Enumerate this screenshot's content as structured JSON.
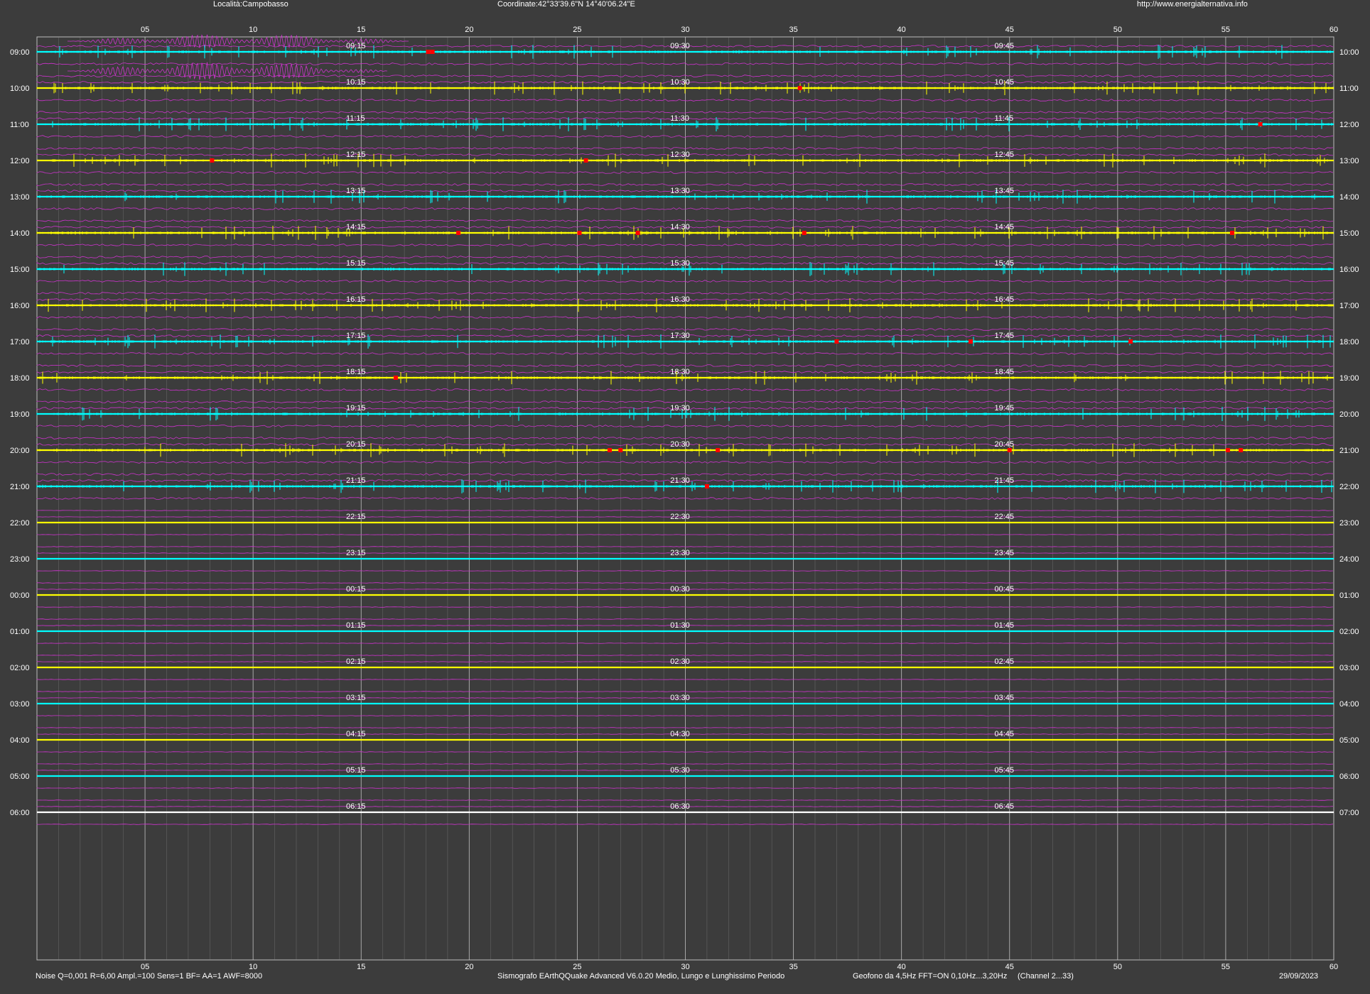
{
  "header": {
    "location": "Località:Campobasso",
    "coordinates": "Coordinate:42°33'39.6\"N  14°40'06.24\"E",
    "url": "http://www.energialternativa.info"
  },
  "footer": {
    "noise": "Noise Q=0,001 R=6,00 Ampl.=100 Sens=1 BF= AA=1 AWF=8000",
    "software": "Sismografo  EArthQQuake Advanced V6.0.20  Medio, Lungo e Lunghissimo Periodo",
    "geofono": "Geofono da 4,5Hz FFT=ON 0,10Hz...3,20Hz",
    "channel": "(Channel 2...33)",
    "date": "29/09/2023"
  },
  "minute_ticks": [
    "05",
    "10",
    "15",
    "20",
    "25",
    "30",
    "35",
    "40",
    "45",
    "50",
    "55",
    "60"
  ],
  "rows": [
    {
      "left": "09:00",
      "right": "10:00",
      "q15": "09:15",
      "q30": "09:30",
      "q45": "09:45",
      "color": "#00ffff",
      "activity": 1,
      "events": [
        18.1,
        18.3
      ]
    },
    {
      "left": "10:00",
      "right": "11:00",
      "q15": "10:15",
      "q30": "10:30",
      "q45": "10:45",
      "color": "#ffff00",
      "activity": 1,
      "events": [
        35.3
      ]
    },
    {
      "left": "11:00",
      "right": "12:00",
      "q15": "11:15",
      "q30": "11:30",
      "q45": "11:45",
      "color": "#00ffff",
      "activity": 1,
      "events": [
        56.6
      ]
    },
    {
      "left": "12:00",
      "right": "13:00",
      "q15": "12:15",
      "q30": "12:30",
      "q45": "12:45",
      "color": "#ffff00",
      "activity": 1,
      "events": [
        8.1,
        25.4
      ]
    },
    {
      "left": "13:00",
      "right": "14:00",
      "q15": "13:15",
      "q30": "13:30",
      "q45": "13:45",
      "color": "#00ffff",
      "activity": 1,
      "events": []
    },
    {
      "left": "14:00",
      "right": "15:00",
      "q15": "14:15",
      "q30": "14:30",
      "q45": "14:45",
      "color": "#ffff00",
      "activity": 1,
      "events": [
        19.5,
        25.1,
        27.8,
        35.5,
        55.3
      ]
    },
    {
      "left": "15:00",
      "right": "16:00",
      "q15": "15:15",
      "q30": "15:30",
      "q45": "15:45",
      "color": "#00ffff",
      "activity": 1,
      "events": []
    },
    {
      "left": "16:00",
      "right": "17:00",
      "q15": "16:15",
      "q30": "16:30",
      "q45": "16:45",
      "color": "#ffff00",
      "activity": 1,
      "events": []
    },
    {
      "left": "17:00",
      "right": "18:00",
      "q15": "17:15",
      "q30": "17:30",
      "q45": "17:45",
      "color": "#00ffff",
      "activity": 1,
      "events": [
        37.0,
        43.2,
        50.6
      ]
    },
    {
      "left": "18:00",
      "right": "19:00",
      "q15": "18:15",
      "q30": "18:30",
      "q45": "18:45",
      "color": "#ffff00",
      "activity": 1,
      "events": [
        16.6
      ]
    },
    {
      "left": "19:00",
      "right": "20:00",
      "q15": "19:15",
      "q30": "19:30",
      "q45": "19:45",
      "color": "#00ffff",
      "activity": 1,
      "events": []
    },
    {
      "left": "20:00",
      "right": "21:00",
      "q15": "20:15",
      "q30": "20:30",
      "q45": "20:45",
      "color": "#ffff00",
      "activity": 1,
      "events": [
        26.5,
        27.0,
        31.5,
        45.0,
        55.1,
        55.7
      ]
    },
    {
      "left": "21:00",
      "right": "22:00",
      "q15": "21:15",
      "q30": "21:30",
      "q45": "21:45",
      "color": "#00ffff",
      "activity": 1,
      "events": [
        31.0
      ]
    },
    {
      "left": "22:00",
      "right": "23:00",
      "q15": "22:15",
      "q30": "22:30",
      "q45": "22:45",
      "color": "#ffff00",
      "activity": 0,
      "events": []
    },
    {
      "left": "23:00",
      "right": "24:00",
      "q15": "23:15",
      "q30": "23:30",
      "q45": "23:45",
      "color": "#00ffff",
      "activity": 0,
      "events": []
    },
    {
      "left": "00:00",
      "right": "01:00",
      "q15": "00:15",
      "q30": "00:30",
      "q45": "00:45",
      "color": "#ffff00",
      "activity": 0,
      "events": []
    },
    {
      "left": "01:00",
      "right": "02:00",
      "q15": "01:15",
      "q30": "01:30",
      "q45": "01:45",
      "color": "#00ffff",
      "activity": 0,
      "events": []
    },
    {
      "left": "02:00",
      "right": "03:00",
      "q15": "02:15",
      "q30": "02:30",
      "q45": "02:45",
      "color": "#ffff00",
      "activity": 0,
      "events": []
    },
    {
      "left": "03:00",
      "right": "04:00",
      "q15": "03:15",
      "q30": "03:30",
      "q45": "03:45",
      "color": "#00ffff",
      "activity": 0,
      "events": []
    },
    {
      "left": "04:00",
      "right": "05:00",
      "q15": "04:15",
      "q30": "04:30",
      "q45": "04:45",
      "color": "#ffff00",
      "activity": 0,
      "events": []
    },
    {
      "left": "05:00",
      "right": "06:00",
      "q15": "05:15",
      "q30": "05:30",
      "q45": "05:45",
      "color": "#00ffff",
      "activity": 0,
      "events": []
    },
    {
      "left": "06:00",
      "right": "07:00",
      "q15": "06:15",
      "q30": "06:30",
      "q45": "06:45",
      "color": "#ffffff",
      "activity": 0,
      "events": []
    }
  ],
  "colors": {
    "background": "#3c3c3c",
    "grid": "#8a8a8a",
    "filtered_trace": "#cc33cc",
    "event_marker": "#ff0000"
  }
}
